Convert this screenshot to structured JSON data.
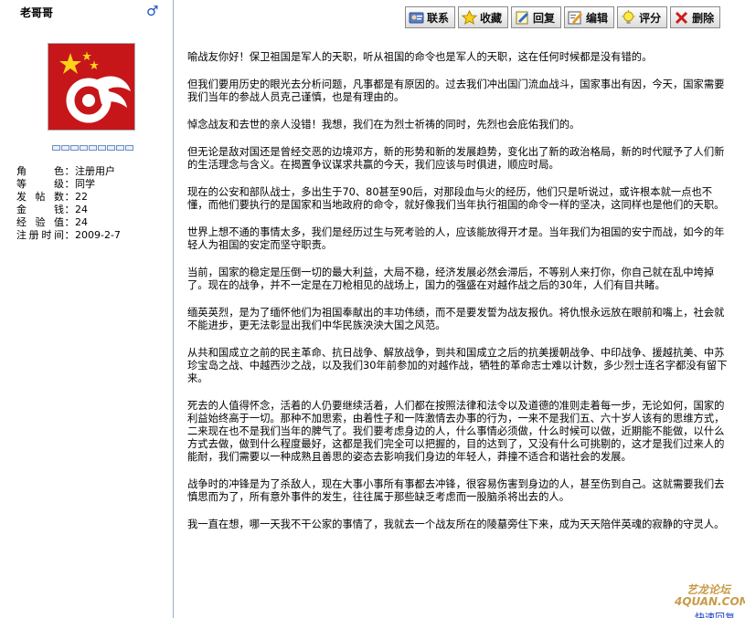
{
  "user": {
    "name": "老哥哥",
    "gender_symbol": "♂",
    "rank_slots": 9,
    "fields": [
      {
        "label": "角色",
        "value": "注册用户"
      },
      {
        "label": "等级",
        "value": "同学"
      },
      {
        "label": "发帖数",
        "value": "22"
      },
      {
        "label": "金钱",
        "value": "24"
      },
      {
        "label": "经验值",
        "value": "24"
      },
      {
        "label": "注册时间",
        "value": "2009-2-7"
      }
    ]
  },
  "toolbar": {
    "contact": "联系",
    "favorite": "收藏",
    "reply": "回复",
    "edit": "编辑",
    "rate": "评分",
    "delete": "删除"
  },
  "post": {
    "paragraphs": [
      "喻战友你好！保卫祖国是军人的天职，听从祖国的命令也是军人的天职，这在任何时候都是没有错的。",
      "但我们要用历史的眼光去分析问题，凡事都是有原因的。过去我们冲出国门流血战斗，国家事出有因，今天，国家需要我们当年的参战人员克己谨慎，也是有理由的。",
      "悼念战友和去世的亲人没错！我想，我们在为烈士祈祷的同时，先烈也会庇佑我们的。",
      "但无论是敌对国还是曾经交恶的边境邓方，新的形势和新的发展趋势，变化出了新的政治格局，新的时代赋予了人们新的生活理念与含义。在揭置争议谋求共赢的今天，我们应该与时俱进，顺应时局。",
      "现在的公安和部队战士，多出生于70、80甚至90后，对那段血与火的经历，他们只是听说过，或许根本就一点也不懂，而他们要执行的是国家和当地政府的命令，就好像我们当年执行祖国的命令一样的坚决，这同样也是他们的天职。",
      "世界上想不通的事情太多，我们是经历过生与死考验的人，应该能放得开才是。当年我们为祖国的安宁而战，如今的年轻人为祖国的安定而坚守职责。",
      "当前，国家的稳定是压倒一切的最大利益，大局不稳，经济发展必然会滞后，不等别人来打你，你自己就在乱中垮掉了。现在的战争，并不一定是在刀枪相见的战场上，国力的强盛在对越作战之后的30年，人们有目共睹。",
      "缅英英烈，是为了缅怀他们为祖国奉献出的丰功伟绩，而不是要发誓为战友报仇。将仇恨永远放在眼前和嘴上，社会就不能进步，更无法彰显出我们中华民族泱泱大国之风范。",
      "从共和国成立之前的民主革命、抗日战争、解放战争，到共和国成立之后的抗美援朝战争、中印战争、援越抗美、中苏珍宝岛之战、中越西沙之战，以及我们30年前参加的对越作战，牺牲的革命志士难以计数，多少烈士连名字都没有留下来。",
      "死去的人值得怀念，活着的人仍要继续活着，人们都在按照法律和法令以及道德的准则走着每一步，无论如何，国家的利益始终高于一切。那种不加思索，由着性子和一阵激情去办事的行为，一来不是我们五、六十岁人该有的思维方式，二来现在也不是我们当年的脾气了。我们要考虑身边的人，什么事情必须做，什么时候可以做，近期能不能做，以什么方式去做，做到什么程度最好，这都是我们完全可以把握的，目的达到了，又没有什么可挑剔的，这才是我们过来人的能耐，我们需要以一种成熟且善思的姿态去影响我们身边的年轻人，莽撞不适合和谐社会的发展。",
      "战争时的冲锋是为了杀敌人，现在大事小事所有事都去冲锋，很容易伤害到身边的人，甚至伤到自己。这就需要我们去慎思而为了，所有意外事件的发生，往往属于那些缺乏考虑而一股脑杀将出去的人。",
      "我一直在想，哪一天我不干公家的事情了，我就去一个战友所在的陵墓旁住下来，成为天天陪伴英魂的寂静的守灵人。"
    ]
  },
  "watermark": {
    "line1": "艺龙论坛",
    "line2": "4QUAN.COM"
  },
  "quick_reply": "快速回复",
  "colors": {
    "sidebar_border": "#9ab0cf",
    "avatar_red": "#c6161a",
    "gender_blue": "#1a4fc4"
  }
}
